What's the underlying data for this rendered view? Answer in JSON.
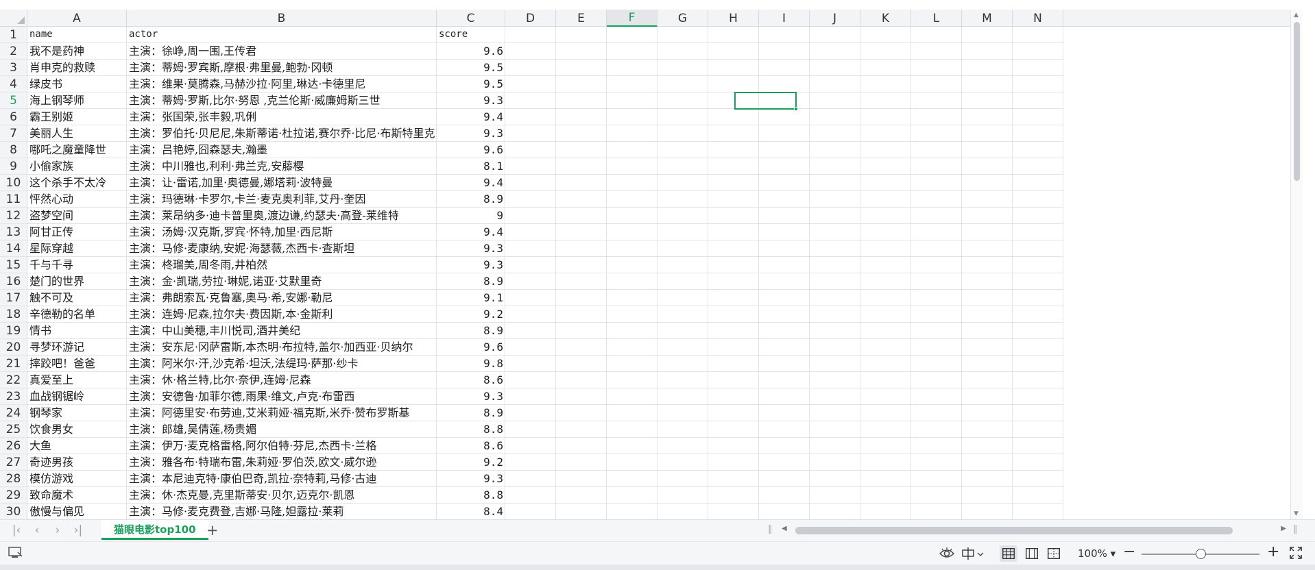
{
  "columns": [
    "A",
    "B",
    "C",
    "D",
    "E",
    "F",
    "G",
    "H",
    "I",
    "J",
    "K",
    "L",
    "M",
    "N"
  ],
  "active_column": "F",
  "active_row": "5",
  "header_row": [
    "name",
    "actor",
    "score"
  ],
  "rows": [
    {
      "n": "1"
    },
    {
      "n": "2",
      "name": "我不是药神",
      "actor": "主演：徐峥,周一围,王传君",
      "score": "9.6"
    },
    {
      "n": "3",
      "name": "肖申克的救赎",
      "actor": "主演：蒂姆·罗宾斯,摩根·弗里曼,鲍勃·冈顿",
      "score": "9.5"
    },
    {
      "n": "4",
      "name": "绿皮书",
      "actor": "主演：维果·莫腾森,马赫沙拉·阿里,琳达·卡德里尼",
      "score": "9.5"
    },
    {
      "n": "5",
      "name": "海上钢琴师",
      "actor": "主演：蒂姆·罗斯,比尔·努恩 ,克兰伦斯·威廉姆斯三世",
      "score": "9.3"
    },
    {
      "n": "6",
      "name": "霸王别姬",
      "actor": "主演：张国荣,张丰毅,巩俐",
      "score": "9.4"
    },
    {
      "n": "7",
      "name": "美丽人生",
      "actor": "主演：罗伯托·贝尼尼,朱斯蒂诺·杜拉诺,赛尔乔·比尼·布斯特里克",
      "score": "9.3"
    },
    {
      "n": "8",
      "name": "哪吒之魔童降世",
      "actor": "主演：吕艳婷,囧森瑟夫,瀚墨",
      "score": "9.6"
    },
    {
      "n": "9",
      "name": "小偷家族",
      "actor": "主演：中川雅也,利利·弗兰克,安藤樱",
      "score": "8.1"
    },
    {
      "n": "10",
      "name": "这个杀手不太冷",
      "actor": "主演：让·雷诺,加里·奥德曼,娜塔莉·波特曼",
      "score": "9.4"
    },
    {
      "n": "11",
      "name": "怦然心动",
      "actor": "主演：玛德琳·卡罗尔,卡兰·麦克奥利菲,艾丹·奎因",
      "score": "8.9"
    },
    {
      "n": "12",
      "name": "盗梦空间",
      "actor": "主演：莱昂纳多·迪卡普里奥,渡边谦,约瑟夫·高登-莱维特",
      "score": "9"
    },
    {
      "n": "13",
      "name": "阿甘正传",
      "actor": "主演：汤姆·汉克斯,罗宾·怀特,加里·西尼斯",
      "score": "9.4"
    },
    {
      "n": "14",
      "name": "星际穿越",
      "actor": "主演：马修·麦康纳,安妮·海瑟薇,杰西卡·查斯坦",
      "score": "9.3"
    },
    {
      "n": "15",
      "name": "千与千寻",
      "actor": "主演：柊瑠美,周冬雨,井柏然",
      "score": "9.3"
    },
    {
      "n": "16",
      "name": "楚门的世界",
      "actor": "主演：金·凯瑞,劳拉·琳妮,诺亚·艾默里奇",
      "score": "8.9"
    },
    {
      "n": "17",
      "name": "触不可及",
      "actor": "主演：弗朗索瓦·克鲁塞,奥马·希,安娜·勒尼",
      "score": "9.1"
    },
    {
      "n": "18",
      "name": "辛德勒的名单",
      "actor": "主演：连姆·尼森,拉尔夫·费因斯,本·金斯利",
      "score": "9.2"
    },
    {
      "n": "19",
      "name": "情书",
      "actor": "主演：中山美穗,丰川悦司,酒井美纪",
      "score": "8.9"
    },
    {
      "n": "20",
      "name": "寻梦环游记",
      "actor": "主演：安东尼·冈萨雷斯,本杰明·布拉特,盖尔·加西亚·贝纳尔",
      "score": "9.6"
    },
    {
      "n": "21",
      "name": "摔跤吧！爸爸",
      "actor": "主演：阿米尔·汗,沙克希·坦沃,法缇玛·萨那·纱卡",
      "score": "9.8"
    },
    {
      "n": "22",
      "name": "真爱至上",
      "actor": "主演：休·格兰特,比尔·奈伊,连姆·尼森",
      "score": "8.6"
    },
    {
      "n": "23",
      "name": "血战钢锯岭",
      "actor": "主演：安德鲁·加菲尔德,雨果·维文,卢克·布雷西",
      "score": "9.3"
    },
    {
      "n": "24",
      "name": "钢琴家",
      "actor": "主演：阿德里安·布劳迪,艾米莉娅·福克斯,米乔·赞布罗斯基",
      "score": "8.9"
    },
    {
      "n": "25",
      "name": "饮食男女",
      "actor": "主演：郎雄,吴倩莲,杨贵媚",
      "score": "8.8"
    },
    {
      "n": "26",
      "name": "大鱼",
      "actor": "主演：伊万·麦克格雷格,阿尔伯特·芬尼,杰西卡·兰格",
      "score": "8.6"
    },
    {
      "n": "27",
      "name": "奇迹男孩",
      "actor": "主演：雅各布·特瑞布雷,朱莉娅·罗伯茨,欧文·威尔逊",
      "score": "9.2"
    },
    {
      "n": "28",
      "name": "模仿游戏",
      "actor": "主演：本尼迪克特·康伯巴奇,凯拉·奈特莉,马修·古迪",
      "score": "9.3"
    },
    {
      "n": "29",
      "name": "致命魔术",
      "actor": "主演：休·杰克曼,克里斯蒂安·贝尔,迈克尔·凯恩",
      "score": "8.8"
    },
    {
      "n": "30",
      "name": "傲慢与偏见",
      "actor": "主演：马修·麦克费登,吉娜·马隆,妲露拉·莱莉",
      "score": "8.4"
    }
  ],
  "sheet_tab": "猫眼电影top100",
  "zoom_label": "100%",
  "colors": {
    "accent": "#1a9f5a"
  }
}
